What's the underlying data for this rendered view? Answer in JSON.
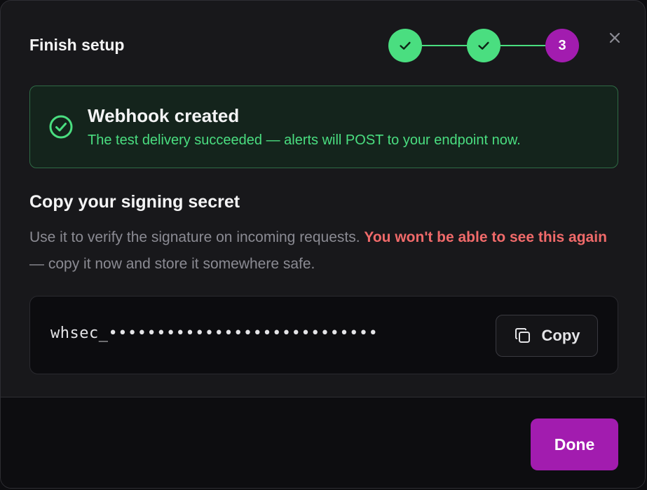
{
  "dialog": {
    "title": "Finish setup",
    "close_icon": "close-icon"
  },
  "stepper": {
    "steps": [
      {
        "state": "complete",
        "icon": "check-icon"
      },
      {
        "state": "complete",
        "icon": "check-icon"
      },
      {
        "state": "current",
        "label": "3"
      }
    ],
    "colors": {
      "complete": "#4ade80",
      "current": "#a21caf"
    }
  },
  "alert": {
    "icon": "check-circle-icon",
    "title": "Webhook created",
    "body": "The test delivery succeeded — alerts will POST to your endpoint now.",
    "color": "#4ade80"
  },
  "secret_section": {
    "title": "Copy your signing secret",
    "description_start": "Use it to verify the signature on incoming requests. ",
    "description_warning": "You won't be able to see this again",
    "description_end": " — copy it now and store it somewhere safe.",
    "warning_color": "#f06a6a",
    "secret_value": "whsec_••••••••••••••••••••••••••••",
    "copy_button": {
      "label": "Copy",
      "icon": "copy-icon"
    }
  },
  "footer": {
    "done_label": "Done",
    "accent": "#a21caf"
  }
}
